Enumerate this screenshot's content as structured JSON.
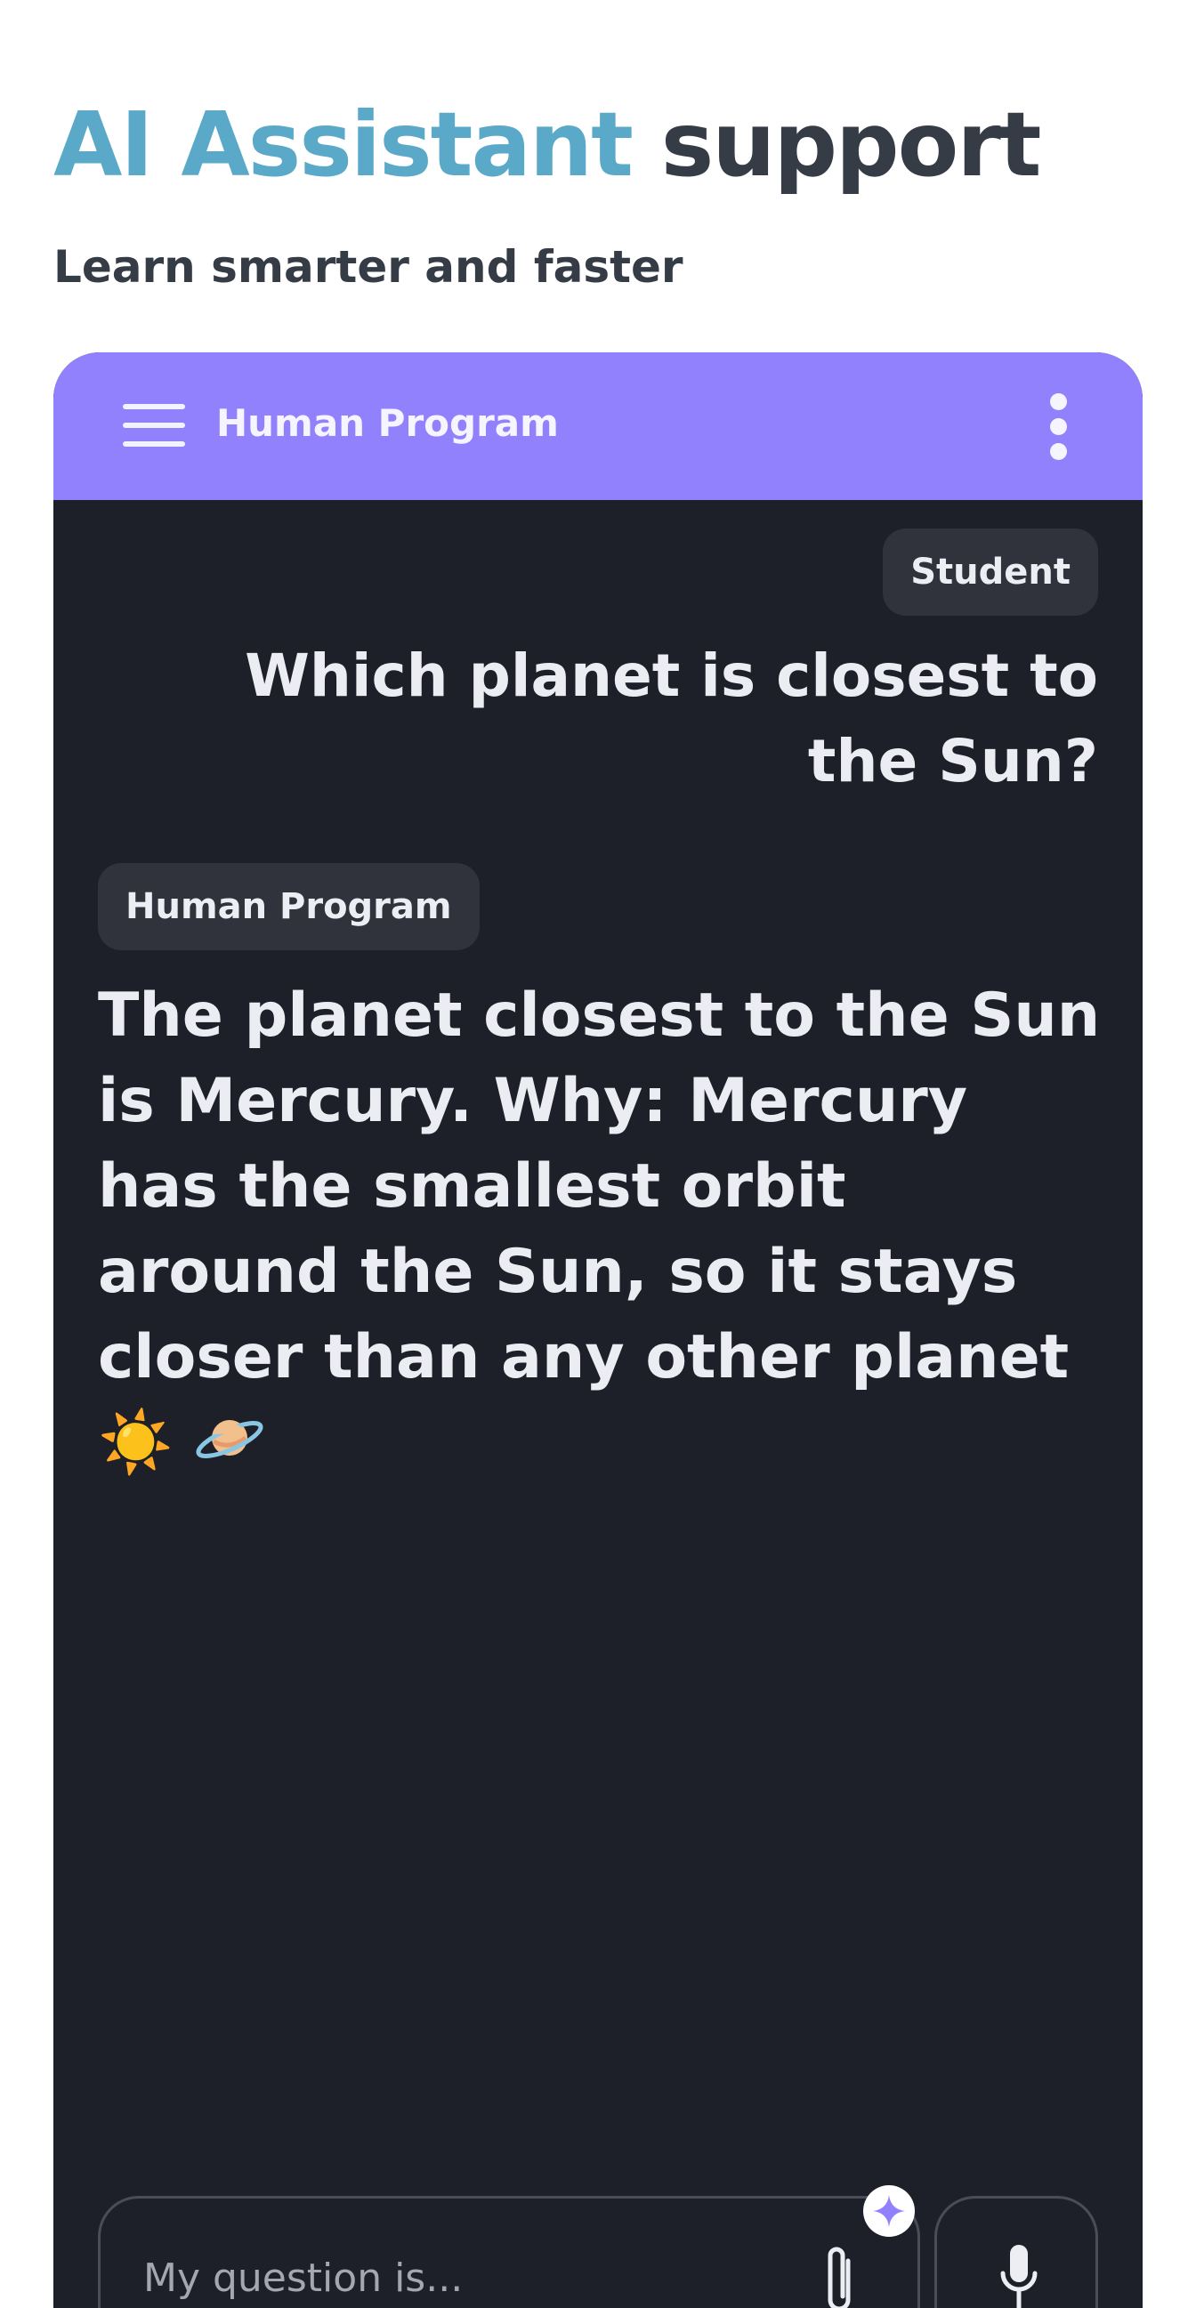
{
  "hero": {
    "title_accent": "AI Assistant",
    "title_rest": " support",
    "subtitle": "Learn smarter and faster"
  },
  "app_bar": {
    "title": "Human Program",
    "menu_icon": "hamburger-menu-icon",
    "more_icon": "more-vertical-icon",
    "background_color": "#9281fc"
  },
  "conversation": {
    "messages": [
      {
        "sender": "Student",
        "text": "Which planet is closest to the Sun?"
      },
      {
        "sender": "Human Program",
        "text": "The planet closest to the Sun is Mercury. Why: Mercury has the smallest orbit around the Sun, so it stays closer than any other planet ☀️",
        "trailing_icon": "ringed-planet-icon"
      }
    ]
  },
  "composer": {
    "placeholder": "My question is...",
    "attach_icon": "paperclip-icon",
    "ai_badge_icon": "sparkle-icon",
    "mic_icon": "microphone-icon"
  },
  "colors": {
    "accent": "#5aa9c9",
    "heading": "#353c46",
    "chat_background": "#1e2029",
    "bubble_label": "#30323c",
    "brand_purple": "#9281fc"
  }
}
